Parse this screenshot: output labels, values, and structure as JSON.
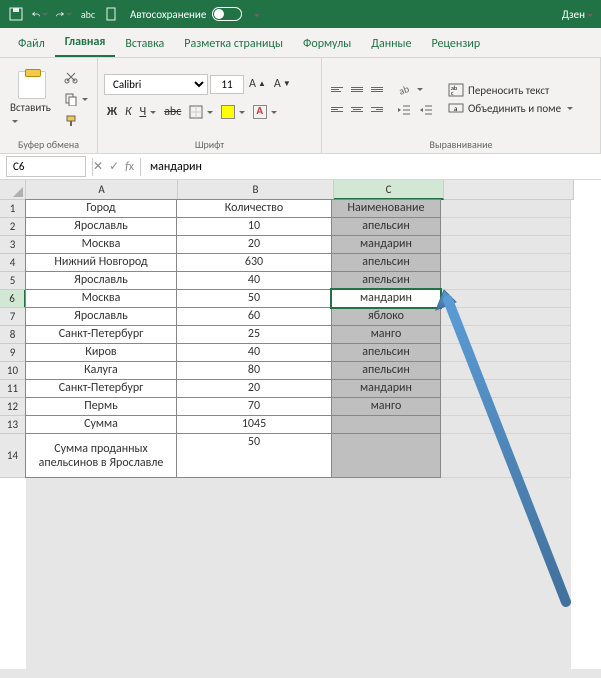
{
  "titlebar": {
    "autosave_label": "Автосохранение",
    "dzen": "Дзен"
  },
  "tabs": {
    "file": "Файл",
    "home": "Главная",
    "insert": "Вставка",
    "layout": "Разметка страницы",
    "formulas": "Формулы",
    "data": "Данные",
    "review": "Рецензир"
  },
  "ribbon": {
    "clipboard": {
      "paste": "Вставить",
      "label": "Буфер обмена"
    },
    "font": {
      "name": "Calibri",
      "size": "11",
      "label": "Шрифт"
    },
    "align": {
      "wrap": "Переносить текст",
      "merge": "Объединить и поме",
      "label": "Выравнивание"
    }
  },
  "namebox": "C6",
  "formula": "мандарин",
  "cols": {
    "A": "A",
    "B": "B",
    "C": "C"
  },
  "rows": [
    "1",
    "2",
    "3",
    "4",
    "5",
    "6",
    "7",
    "8",
    "9",
    "10",
    "11",
    "12",
    "13",
    "14"
  ],
  "table": {
    "headers": {
      "a": "Город",
      "b": "Количество",
      "c": "Наименование"
    },
    "data": [
      {
        "a": "Ярославль",
        "b": "10",
        "c": "апельсин"
      },
      {
        "a": "Москва",
        "b": "20",
        "c": "мандарин"
      },
      {
        "a": "Нижний Новгород",
        "b": "630",
        "c": "апельсин"
      },
      {
        "a": "Ярославль",
        "b": "40",
        "c": "апельсин"
      },
      {
        "a": "Москва",
        "b": "50",
        "c": "мандарин"
      },
      {
        "a": "Ярославль",
        "b": "60",
        "c": "яблоко"
      },
      {
        "a": "Санкт-Петербург",
        "b": "25",
        "c": "манго"
      },
      {
        "a": "Киров",
        "b": "40",
        "c": "апельсин"
      },
      {
        "a": "Калуга",
        "b": "80",
        "c": "апельсин"
      },
      {
        "a": "Санкт-Петербург",
        "b": "20",
        "c": "мандарин"
      },
      {
        "a": "Пермь",
        "b": "70",
        "c": "манго"
      }
    ],
    "sum": {
      "a": "Сумма",
      "b": "1045"
    },
    "footer": {
      "a": "Сумма проданных апельсинов в Ярославле",
      "b": "50"
    }
  }
}
